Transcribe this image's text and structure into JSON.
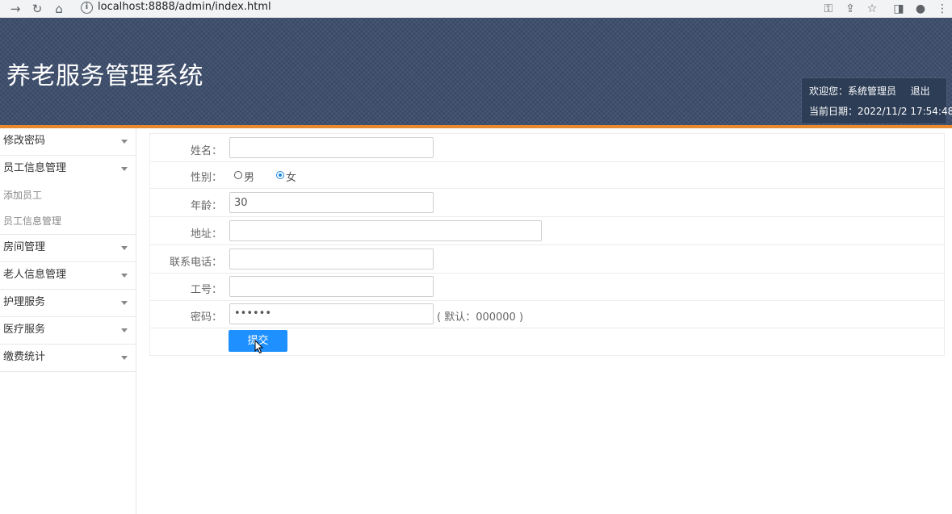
{
  "browser": {
    "url": "localhost:8888/admin/index.html"
  },
  "header": {
    "title": "养老服务管理系统",
    "welcome": "欢迎您：系统管理员",
    "logout": "退出",
    "date_label": "当前日期：2022/11/2 17:54:48"
  },
  "sidebar": {
    "items": [
      {
        "label": "修改密码"
      },
      {
        "label": "员工信息管理"
      },
      {
        "label": "房间管理"
      },
      {
        "label": "老人信息管理"
      },
      {
        "label": "护理服务"
      },
      {
        "label": "医疗服务"
      },
      {
        "label": "缴费统计"
      }
    ],
    "sub_items": [
      {
        "label": "添加员工"
      },
      {
        "label": "员工信息管理"
      }
    ]
  },
  "form": {
    "name_label": "姓名：",
    "name_value": "",
    "gender_label": "性别：",
    "gender_male": "男",
    "gender_female": "女",
    "gender_selected": "女",
    "age_label": "年龄：",
    "age_value": "30",
    "address_label": "地址：",
    "address_value": "",
    "phone_label": "联系电话：",
    "phone_value": "",
    "jobno_label": "工号：",
    "jobno_value": "",
    "password_label": "密码：",
    "password_value": "••••••",
    "password_hint": "( 默认：000000 )",
    "submit_label": "提交"
  },
  "colors": {
    "header_bg": "#3c4d6b",
    "accent_orange": "#e8882f",
    "button_blue": "#1e90ff"
  }
}
